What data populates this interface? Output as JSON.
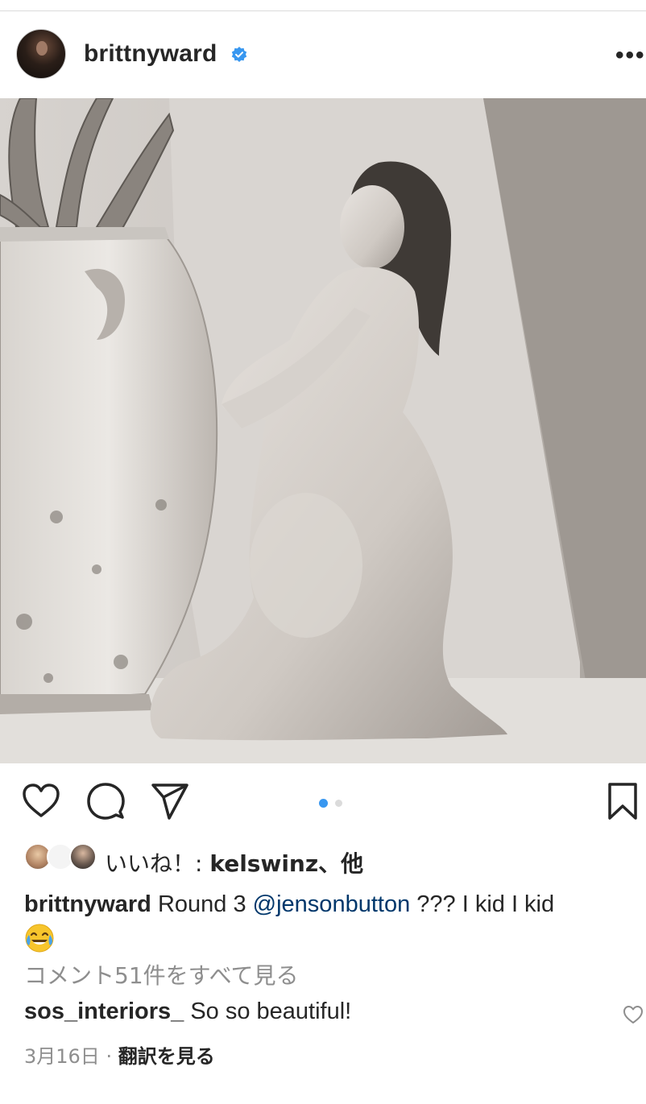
{
  "post": {
    "username": "brittnyward",
    "more_label": "•••",
    "photo_alt_icon": "post-photo"
  },
  "actions": {
    "like_icon": "heart-icon",
    "comment_icon": "comment-icon",
    "share_icon": "send-icon",
    "save_icon": "bookmark-icon",
    "carousel_total": 2,
    "carousel_active": 1
  },
  "likes": {
    "prefix": "いいね！: ",
    "name": "kelswinz",
    "suffix": "、他"
  },
  "caption": {
    "user": "brittnyward",
    "text_before": " Round 3 ",
    "mention": "@jensonbutton",
    "text_after": " ??? I kid I kid",
    "emoji": "face-with-tears-of-joy"
  },
  "comments": {
    "view_all": "コメント51件をすべて見る",
    "items": [
      {
        "user": "sos_interiors_",
        "text": " So so beautiful!"
      }
    ]
  },
  "meta": {
    "date": "3月16日",
    "separator": " · ",
    "translate": "翻訳を見る"
  },
  "colors": {
    "text": "#262626",
    "muted": "#8e8e8e",
    "link": "#00376b",
    "accent": "#3897f0",
    "verified": "#3897f0"
  }
}
